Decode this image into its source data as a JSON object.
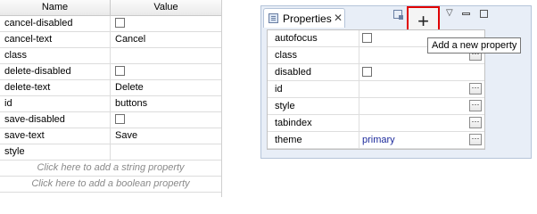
{
  "left_table": {
    "headers": {
      "name": "Name",
      "value": "Value"
    },
    "rows": [
      {
        "name": "cancel-disabled",
        "value": "",
        "checkbox": true
      },
      {
        "name": "cancel-text",
        "value": "Cancel",
        "checkbox": false
      },
      {
        "name": "class",
        "value": "",
        "checkbox": false
      },
      {
        "name": "delete-disabled",
        "value": "",
        "checkbox": true
      },
      {
        "name": "delete-text",
        "value": "Delete",
        "checkbox": false
      },
      {
        "name": "id",
        "value": "buttons",
        "checkbox": false
      },
      {
        "name": "save-disabled",
        "value": "",
        "checkbox": true
      },
      {
        "name": "save-text",
        "value": "Save",
        "checkbox": false
      },
      {
        "name": "style",
        "value": "",
        "checkbox": false
      }
    ],
    "add_string_label": "Click here to add a string property",
    "add_boolean_label": "Click here to add a boolean property"
  },
  "properties_view": {
    "tab_label": "Properties",
    "tab_close": "✕",
    "add_button_icon": "plus-icon",
    "add_button_glyph": "+",
    "menu_glyph": "▽",
    "tooltip": "Add a new property",
    "rows": [
      {
        "name": "autofocus",
        "value": "",
        "checkbox": true,
        "ellipsis": false
      },
      {
        "name": "class",
        "value": "",
        "checkbox": false,
        "ellipsis": true
      },
      {
        "name": "disabled",
        "value": "",
        "checkbox": true,
        "ellipsis": false
      },
      {
        "name": "id",
        "value": "",
        "checkbox": false,
        "ellipsis": true
      },
      {
        "name": "style",
        "value": "",
        "checkbox": false,
        "ellipsis": true
      },
      {
        "name": "tabindex",
        "value": "",
        "checkbox": false,
        "ellipsis": true
      },
      {
        "name": "theme",
        "value": "primary",
        "checkbox": false,
        "ellipsis": true
      }
    ],
    "ellipsis_glyph": "···"
  },
  "colors": {
    "highlight": "#e00000",
    "value_text": "#1d2b9c"
  }
}
